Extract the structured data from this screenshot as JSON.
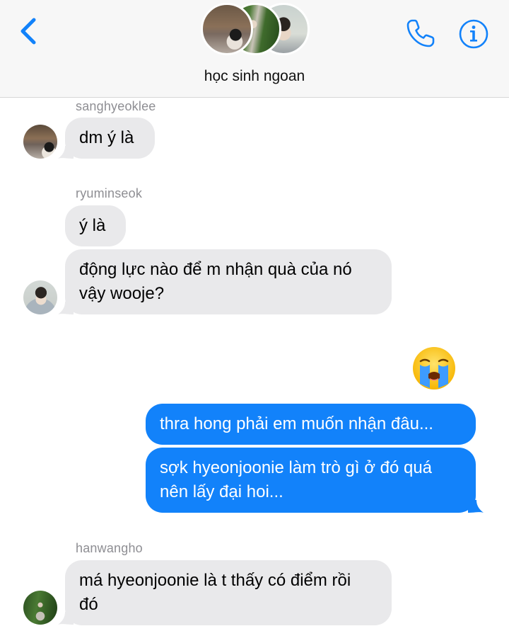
{
  "header": {
    "title": "học sinh ngoan",
    "back_icon": "chevron-left-icon",
    "call_icon": "phone-icon",
    "info_icon": "info-icon",
    "accent_color": "#1282fa"
  },
  "messages": [
    {
      "sender": "sanghyeoklee",
      "text": "dm ý là"
    },
    {
      "sender": "ryuminseok",
      "texts": [
        "ý là",
        "động lực nào để m nhận quà của nó",
        "vậy wooje?"
      ]
    },
    {
      "emoji": "loudly-crying-face"
    },
    {
      "outgoing": [
        "thra hong phải em muốn nhận đâu...",
        "sợk hyeonjoonie làm trò gì ở đó quá",
        "nên lấy đại hoi..."
      ]
    },
    {
      "sender": "hanwangho",
      "texts": [
        "má hyeonjoonie là t thấy có điểm rồi",
        "đó"
      ]
    }
  ],
  "colors": {
    "incoming_bubble": "#e9e9eb",
    "outgoing_bubble": "#1282fa",
    "sender_label": "#8e8e93"
  }
}
